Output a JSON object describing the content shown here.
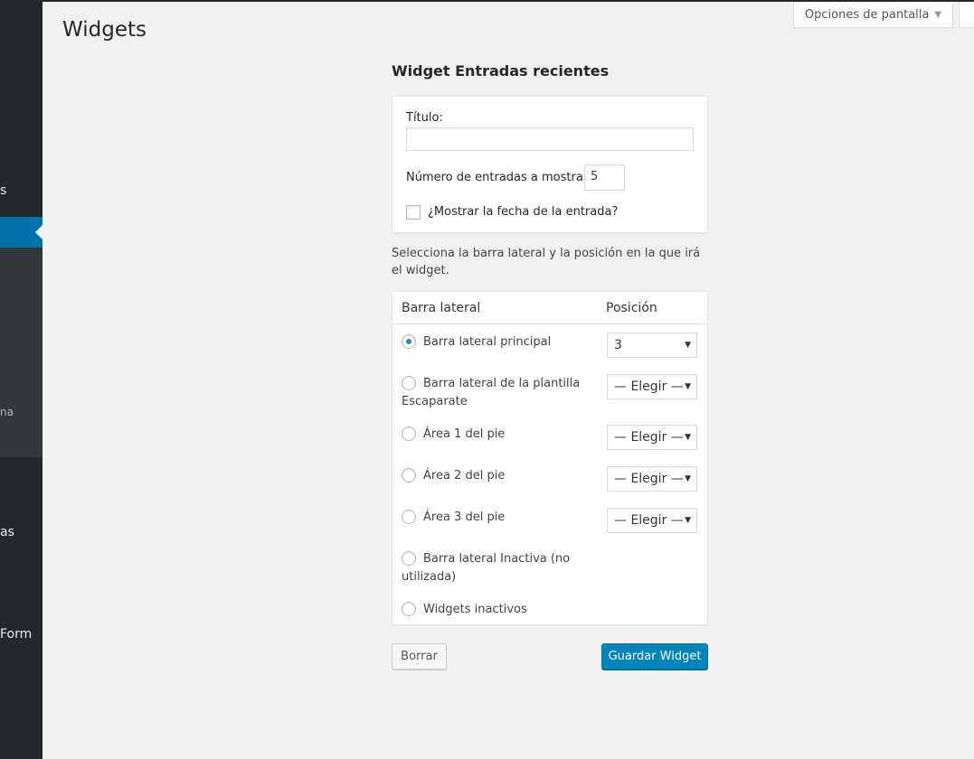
{
  "page": {
    "title": "Widgets",
    "screen_options_label": "Opciones de pantalla"
  },
  "sidebar_fragments": [
    "s",
    "na",
    "as",
    "Form"
  ],
  "widget": {
    "heading": "Widget Entradas recientes",
    "title_label": "Título:",
    "title_value": "",
    "number_label": "Número de entradas a mostrar:",
    "number_value": "5",
    "show_date_label": "¿Mostrar la fecha de la entrada?",
    "show_date_checked": false
  },
  "placement": {
    "description": "Selecciona la barra lateral y la posición en la que irá el widget.",
    "col_sidebar": "Barra lateral",
    "col_position": "Posición",
    "rows": [
      {
        "label": "Barra lateral principal",
        "selected": true,
        "position": "3"
      },
      {
        "label": "Barra lateral de la plantilla Escaparate",
        "selected": false,
        "position": "— Elegir —"
      },
      {
        "label": "Área 1 del pie",
        "selected": false,
        "position": "— Elegir —"
      },
      {
        "label": "Área 2 del pie",
        "selected": false,
        "position": "— Elegir —"
      },
      {
        "label": "Área 3 del pie",
        "selected": false,
        "position": "— Elegir —"
      },
      {
        "label": "Barra lateral Inactiva (no utilizada)",
        "selected": false
      },
      {
        "label": "Widgets inactivos",
        "selected": false
      }
    ]
  },
  "actions": {
    "delete_label": "Borrar",
    "save_label": "Guardar Widget"
  },
  "colors": {
    "sidebar": "#23282d",
    "accent": "#0073aa",
    "primary_button": "#0085ba"
  }
}
